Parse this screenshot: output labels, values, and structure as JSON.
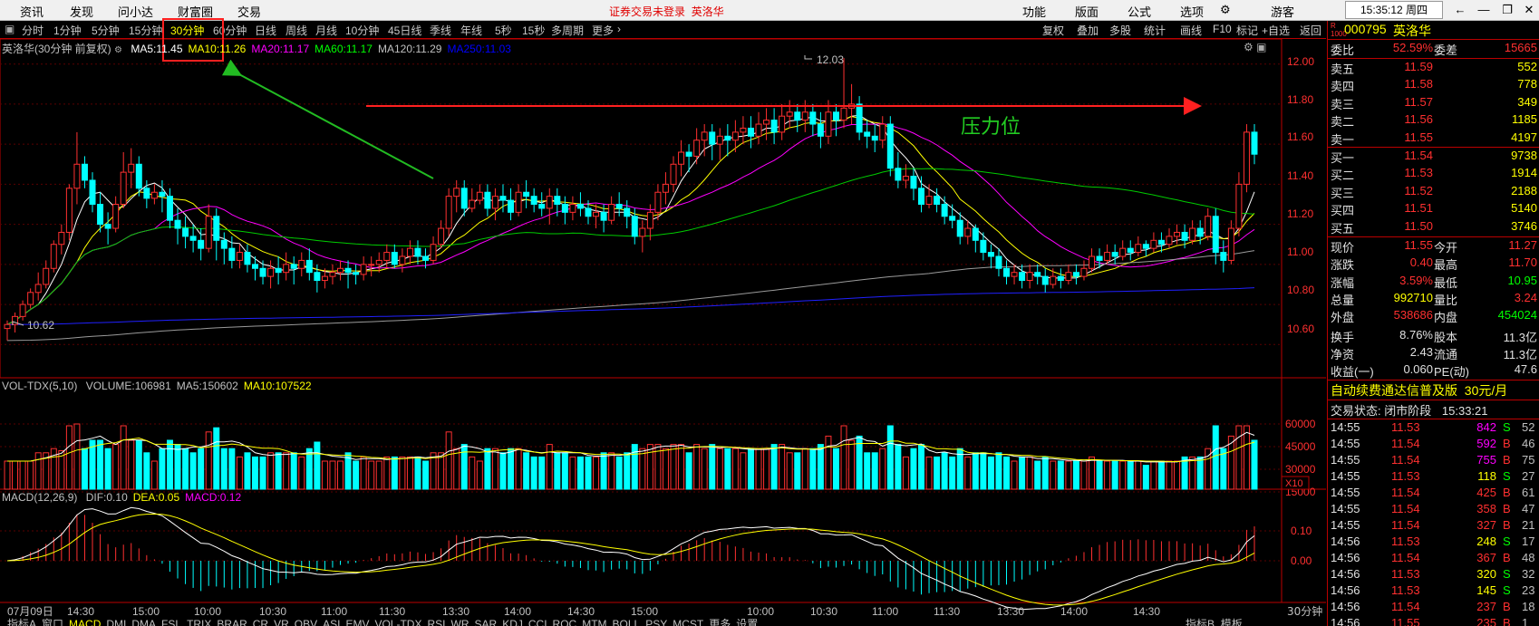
{
  "menu": {
    "items": [
      "资讯",
      "发现",
      "问小达",
      "财富圈",
      "交易"
    ],
    "notice": "证券交易未登录",
    "notice_stock": "英洛华",
    "right_items": [
      "功能",
      "版面",
      "公式",
      "选项"
    ],
    "user": "游客",
    "clock": "15:35:12 周四"
  },
  "period_tabs": [
    "分时",
    "1分钟",
    "5分钟",
    "15分钟",
    "30分钟",
    "60分钟",
    "日线",
    "周线",
    "月线",
    "10分钟",
    "45日线",
    "季线",
    "年线",
    "5秒",
    "15秒",
    "多周期",
    "更多"
  ],
  "active_period": "30分钟",
  "right_tools": [
    "复权",
    "叠加",
    "多股",
    "统计",
    "画线",
    "F10",
    "标记",
    "+自选",
    "返回"
  ],
  "main_legend": {
    "title": "英洛华(30分钟 前复权)",
    "items": [
      {
        "label": "MA5:",
        "value": "11.45",
        "color": "#ffffff"
      },
      {
        "label": "MA10:",
        "value": "11.26",
        "color": "#ffff00"
      },
      {
        "label": "MA20:",
        "value": "11.17",
        "color": "#ff00ff"
      },
      {
        "label": "MA60:",
        "value": "11.17",
        "color": "#00ff00"
      },
      {
        "label": "MA120:",
        "value": "11.29",
        "color": "#c0c0c0"
      },
      {
        "label": "MA250:",
        "value": "11.03",
        "color": "#0000ff"
      }
    ]
  },
  "annotations": {
    "pressure_label": "压力位",
    "high_label": "12.03",
    "low_label": "10.62"
  },
  "price_axis": [
    "12.00",
    "11.80",
    "11.60",
    "11.40",
    "11.20",
    "11.00",
    "10.80",
    "10.60"
  ],
  "vol_legend": {
    "title": "VOL-TDX(5,10)",
    "items": [
      {
        "label": "VOLUME:",
        "value": "106981",
        "color": "#c0c0c0"
      },
      {
        "label": "MA5:",
        "value": "150602",
        "color": "#c0c0c0"
      },
      {
        "label": "MA10:",
        "value": "107522",
        "color": "#ffff00"
      }
    ]
  },
  "vol_axis": [
    "60000",
    "45000",
    "30000",
    "15000"
  ],
  "vol_unit": "X10",
  "macd_legend": {
    "title": "MACD(12,26,9)",
    "items": [
      {
        "label": "DIF:",
        "value": "0.10",
        "color": "#c0c0c0"
      },
      {
        "label": "DEA:",
        "value": "0.05",
        "color": "#ffff00"
      },
      {
        "label": "MACD:",
        "value": "0.12",
        "color": "#ff00ff"
      }
    ]
  },
  "macd_axis": [
    "0.10",
    "0.00"
  ],
  "time_axis": [
    "07月09日",
    "14:30",
    "15:00",
    "10:00",
    "10:30",
    "11:00",
    "11:30",
    "13:30",
    "14:00",
    "14:30",
    "15:00",
    "10:00",
    "10:30",
    "11:00",
    "11:30",
    "13:30",
    "14:00",
    "14:30"
  ],
  "period_label": "30分钟",
  "indicator_tabs": [
    "指标A",
    "窗口",
    "MACD",
    "DMI",
    "DMA",
    "FSL",
    "TRIX",
    "BRAR",
    "CR",
    "VR",
    "OBV",
    "ASI",
    "EMV",
    "VOL-TDX",
    "RSI",
    "WR",
    "SAR",
    "KDJ",
    "CCI",
    "ROC",
    "MTM",
    "BOLL",
    "PSY",
    "MCST",
    "更多",
    "设置"
  ],
  "indicator_right": [
    "指标B",
    "模板"
  ],
  "quote": {
    "code": "000795",
    "name": "英洛华",
    "wei_bi_label": "委比",
    "wei_bi": "52.59%",
    "wei_cha_label": "委差",
    "wei_cha": "15665",
    "asks": [
      {
        "label": "卖五",
        "price": "11.59",
        "vol": "552"
      },
      {
        "label": "卖四",
        "price": "11.58",
        "vol": "778"
      },
      {
        "label": "卖三",
        "price": "11.57",
        "vol": "349"
      },
      {
        "label": "卖二",
        "price": "11.56",
        "vol": "1185"
      },
      {
        "label": "卖一",
        "price": "11.55",
        "vol": "4197"
      }
    ],
    "bids": [
      {
        "label": "买一",
        "price": "11.54",
        "vol": "9738"
      },
      {
        "label": "买二",
        "price": "11.53",
        "vol": "1914"
      },
      {
        "label": "买三",
        "price": "11.52",
        "vol": "2188"
      },
      {
        "label": "买四",
        "price": "11.51",
        "vol": "5140"
      },
      {
        "label": "买五",
        "price": "11.50",
        "vol": "3746"
      }
    ],
    "stats": [
      {
        "l1": "现价",
        "v1": "11.55",
        "c1": "#ff3030",
        "l2": "今开",
        "v2": "11.27",
        "c2": "#ff3030"
      },
      {
        "l1": "涨跌",
        "v1": "0.40",
        "c1": "#ff3030",
        "l2": "最高",
        "v2": "11.70",
        "c2": "#ff3030"
      },
      {
        "l1": "涨幅",
        "v1": "3.59%",
        "c1": "#ff3030",
        "l2": "最低",
        "v2": "10.95",
        "c2": "#00ff00"
      },
      {
        "l1": "总量",
        "v1": "992710",
        "c1": "#ffff00",
        "l2": "量比",
        "v2": "3.24",
        "c2": "#ff3030"
      },
      {
        "l1": "外盘",
        "v1": "538686",
        "c1": "#ff3030",
        "l2": "内盘",
        "v2": "454024",
        "c2": "#00ff00"
      },
      {
        "l1": "换手",
        "v1": "8.76%",
        "c1": "#e0e0e0",
        "l2": "股本",
        "v2": "11.3亿",
        "c2": "#e0e0e0"
      },
      {
        "l1": "净资",
        "v1": "2.43",
        "c1": "#e0e0e0",
        "l2": "流通",
        "v2": "11.3亿",
        "c2": "#e0e0e0"
      },
      {
        "l1": "收益(一)",
        "v1": "0.060",
        "c1": "#e0e0e0",
        "l2": "PE(动)",
        "v2": "47.6",
        "c2": "#e0e0e0"
      }
    ],
    "ad_text": "自动续费通达信普及版",
    "ad_price": "30元/月",
    "trade_status_label": "交易状态:",
    "trade_status": "闭市阶段",
    "trade_time": "15:33:21",
    "ticks": [
      {
        "t": "14:55",
        "p": "11.53",
        "v": "842",
        "s": "S",
        "n": "52"
      },
      {
        "t": "14:55",
        "p": "11.54",
        "v": "592",
        "s": "B",
        "n": "46"
      },
      {
        "t": "14:55",
        "p": "11.54",
        "v": "755",
        "s": "B",
        "n": "75"
      },
      {
        "t": "14:55",
        "p": "11.53",
        "v": "118",
        "s": "S",
        "n": "27"
      },
      {
        "t": "14:55",
        "p": "11.54",
        "v": "425",
        "s": "B",
        "n": "61"
      },
      {
        "t": "14:55",
        "p": "11.54",
        "v": "358",
        "s": "B",
        "n": "47"
      },
      {
        "t": "14:55",
        "p": "11.54",
        "v": "327",
        "s": "B",
        "n": "21"
      },
      {
        "t": "14:56",
        "p": "11.53",
        "v": "248",
        "s": "S",
        "n": "17"
      },
      {
        "t": "14:56",
        "p": "11.54",
        "v": "367",
        "s": "B",
        "n": "48"
      },
      {
        "t": "14:56",
        "p": "11.53",
        "v": "320",
        "s": "S",
        "n": "32"
      },
      {
        "t": "14:56",
        "p": "11.53",
        "v": "145",
        "s": "S",
        "n": "23"
      },
      {
        "t": "14:56",
        "p": "11.54",
        "v": "237",
        "s": "B",
        "n": "18"
      },
      {
        "t": "14:56",
        "p": "11.55",
        "v": "235",
        "s": "B",
        "n": "1"
      }
    ]
  },
  "chart_data": {
    "type": "candlestick",
    "title": "英洛华(30分钟 前复权)",
    "ylim": [
      10.52,
      12.08
    ],
    "candles": [
      [
        10.68,
        10.7,
        10.62,
        10.72
      ],
      [
        10.7,
        10.74,
        10.66,
        10.76
      ],
      [
        10.74,
        10.8,
        10.72,
        10.82
      ],
      [
        10.8,
        10.86,
        10.78,
        10.88
      ],
      [
        10.86,
        10.9,
        10.82,
        10.96
      ],
      [
        10.9,
        10.98,
        10.88,
        11.02
      ],
      [
        10.98,
        11.1,
        10.96,
        11.12
      ],
      [
        11.1,
        11.16,
        11.05,
        11.2
      ],
      [
        11.16,
        11.38,
        11.12,
        11.4
      ],
      [
        11.38,
        11.5,
        11.3,
        11.66
      ],
      [
        11.5,
        11.42,
        11.38,
        11.54
      ],
      [
        11.42,
        11.3,
        11.26,
        11.46
      ],
      [
        11.3,
        11.2,
        11.16,
        11.36
      ],
      [
        11.2,
        11.18,
        11.1,
        11.26
      ],
      [
        11.18,
        11.3,
        11.16,
        11.34
      ],
      [
        11.3,
        11.46,
        11.28,
        11.56
      ],
      [
        11.46,
        11.5,
        11.38,
        11.58
      ],
      [
        11.5,
        11.38,
        11.34,
        11.54
      ],
      [
        11.38,
        11.33,
        11.28,
        11.42
      ],
      [
        11.33,
        11.36,
        11.3,
        11.4
      ],
      [
        11.36,
        11.34,
        11.26,
        11.42
      ],
      [
        11.34,
        11.22,
        11.18,
        11.38
      ],
      [
        11.22,
        11.18,
        11.1,
        11.28
      ],
      [
        11.18,
        11.14,
        11.08,
        11.24
      ],
      [
        11.14,
        11.12,
        11.06,
        11.2
      ],
      [
        11.12,
        11.08,
        11.02,
        11.18
      ],
      [
        11.08,
        11.24,
        11.06,
        11.3
      ],
      [
        11.24,
        11.12,
        11.02,
        11.28
      ],
      [
        11.12,
        11.08,
        11.0,
        11.16
      ],
      [
        11.08,
        11.02,
        10.98,
        11.14
      ],
      [
        11.02,
        11.06,
        10.98,
        11.1
      ],
      [
        11.06,
        11.0,
        10.96,
        11.1
      ],
      [
        11.0,
        10.98,
        10.92,
        11.04
      ],
      [
        10.98,
        10.94,
        10.9,
        11.02
      ],
      [
        10.94,
        10.98,
        10.88,
        11.02
      ],
      [
        10.98,
        10.96,
        10.9,
        11.04
      ],
      [
        10.96,
        11.0,
        10.92,
        11.06
      ],
      [
        11.0,
        10.98,
        10.9,
        11.04
      ],
      [
        10.98,
        11.02,
        10.94,
        11.06
      ],
      [
        11.02,
        10.96,
        10.92,
        11.08
      ],
      [
        10.96,
        10.92,
        10.86,
        11.0
      ],
      [
        10.92,
        10.94,
        10.88,
        10.98
      ],
      [
        10.94,
        10.96,
        10.9,
        11.0
      ],
      [
        10.96,
        10.98,
        10.92,
        11.02
      ],
      [
        10.98,
        10.96,
        10.88,
        11.02
      ],
      [
        10.96,
        10.95,
        10.9,
        11.0
      ],
      [
        10.95,
        11.0,
        10.92,
        11.04
      ],
      [
        11.0,
        11.0,
        10.94,
        11.04
      ],
      [
        11.0,
        11.02,
        10.96,
        11.06
      ],
      [
        11.02,
        11.06,
        10.98,
        11.1
      ],
      [
        11.06,
        11.0,
        10.98,
        11.1
      ],
      [
        11.0,
        11.04,
        10.96,
        11.08
      ],
      [
        11.04,
        11.08,
        11.0,
        11.12
      ],
      [
        11.08,
        11.04,
        11.0,
        11.12
      ],
      [
        11.04,
        11.02,
        10.98,
        11.08
      ],
      [
        11.02,
        11.1,
        11.0,
        11.14
      ],
      [
        11.1,
        11.18,
        11.08,
        11.22
      ],
      [
        11.18,
        11.34,
        11.14,
        11.38
      ],
      [
        11.34,
        11.38,
        11.26,
        11.42
      ],
      [
        11.38,
        11.28,
        11.24,
        11.42
      ],
      [
        11.28,
        11.32,
        11.26,
        11.38
      ],
      [
        11.32,
        11.36,
        11.3,
        11.4
      ],
      [
        11.36,
        11.28,
        11.24,
        11.4
      ],
      [
        11.28,
        11.34,
        11.22,
        11.38
      ],
      [
        11.34,
        11.32,
        11.26,
        11.4
      ],
      [
        11.32,
        11.26,
        11.22,
        11.38
      ],
      [
        11.26,
        11.36,
        11.24,
        11.4
      ],
      [
        11.36,
        11.34,
        11.28,
        11.42
      ],
      [
        11.34,
        11.3,
        11.26,
        11.38
      ],
      [
        11.3,
        11.28,
        11.24,
        11.36
      ],
      [
        11.28,
        11.34,
        11.2,
        11.38
      ],
      [
        11.34,
        11.3,
        11.24,
        11.38
      ],
      [
        11.3,
        11.26,
        11.2,
        11.34
      ],
      [
        11.26,
        11.3,
        11.22,
        11.34
      ],
      [
        11.3,
        11.28,
        11.24,
        11.36
      ],
      [
        11.28,
        11.24,
        11.2,
        11.32
      ],
      [
        11.24,
        11.26,
        11.18,
        11.3
      ],
      [
        11.26,
        11.22,
        11.16,
        11.3
      ],
      [
        11.22,
        11.3,
        11.2,
        11.34
      ],
      [
        11.3,
        11.28,
        11.24,
        11.36
      ],
      [
        11.28,
        11.24,
        11.18,
        11.32
      ],
      [
        11.24,
        11.14,
        11.1,
        11.28
      ],
      [
        11.14,
        11.18,
        11.06,
        11.22
      ],
      [
        11.18,
        11.26,
        11.12,
        11.3
      ],
      [
        11.26,
        11.36,
        11.22,
        11.4
      ],
      [
        11.36,
        11.4,
        11.3,
        11.46
      ],
      [
        11.4,
        11.5,
        11.36,
        11.54
      ],
      [
        11.5,
        11.56,
        11.44,
        11.62
      ],
      [
        11.56,
        11.54,
        11.46,
        11.6
      ],
      [
        11.54,
        11.62,
        11.5,
        11.68
      ],
      [
        11.62,
        11.66,
        11.54,
        11.7
      ],
      [
        11.66,
        11.6,
        11.52,
        11.7
      ],
      [
        11.6,
        11.64,
        11.52,
        11.68
      ],
      [
        11.64,
        11.62,
        11.54,
        11.7
      ],
      [
        11.62,
        11.66,
        11.56,
        11.72
      ],
      [
        11.66,
        11.68,
        11.6,
        11.74
      ],
      [
        11.68,
        11.64,
        11.58,
        11.74
      ],
      [
        11.64,
        11.7,
        11.6,
        11.76
      ],
      [
        11.7,
        11.72,
        11.62,
        11.78
      ],
      [
        11.72,
        11.66,
        11.6,
        11.78
      ],
      [
        11.66,
        11.74,
        11.62,
        11.8
      ],
      [
        11.74,
        11.76,
        11.68,
        11.82
      ],
      [
        11.76,
        11.72,
        11.66,
        11.8
      ],
      [
        11.72,
        11.76,
        11.66,
        11.82
      ],
      [
        11.76,
        11.7,
        11.64,
        11.8
      ],
      [
        11.7,
        11.64,
        11.58,
        11.76
      ],
      [
        11.64,
        11.76,
        11.6,
        11.82
      ],
      [
        11.76,
        11.72,
        11.64,
        11.8
      ],
      [
        11.72,
        11.78,
        11.68,
        12.03
      ],
      [
        11.78,
        11.8,
        11.7,
        11.9
      ],
      [
        11.8,
        11.66,
        11.62,
        11.84
      ],
      [
        11.66,
        11.64,
        11.58,
        11.72
      ],
      [
        11.64,
        11.62,
        11.56,
        11.7
      ],
      [
        11.62,
        11.7,
        11.58,
        11.74
      ],
      [
        11.7,
        11.48,
        11.44,
        11.74
      ],
      [
        11.48,
        11.42,
        11.38,
        11.56
      ],
      [
        11.42,
        11.44,
        11.38,
        11.5
      ],
      [
        11.44,
        11.38,
        11.32,
        11.48
      ],
      [
        11.38,
        11.3,
        11.26,
        11.44
      ],
      [
        11.3,
        11.34,
        11.28,
        11.4
      ],
      [
        11.34,
        11.3,
        11.26,
        11.38
      ],
      [
        11.3,
        11.24,
        11.2,
        11.34
      ],
      [
        11.24,
        11.22,
        11.18,
        11.3
      ],
      [
        11.22,
        11.14,
        11.1,
        11.26
      ],
      [
        11.14,
        11.18,
        11.1,
        11.22
      ],
      [
        11.18,
        11.12,
        11.06,
        11.2
      ],
      [
        11.12,
        11.06,
        11.02,
        11.16
      ],
      [
        11.06,
        11.04,
        10.98,
        11.1
      ],
      [
        11.04,
        10.98,
        10.94,
        11.08
      ],
      [
        10.98,
        10.94,
        10.9,
        11.02
      ],
      [
        10.94,
        10.96,
        10.9,
        11.0
      ],
      [
        10.96,
        10.92,
        10.88,
        11.0
      ],
      [
        10.92,
        10.96,
        10.88,
        11.0
      ],
      [
        10.96,
        10.94,
        10.9,
        11.0
      ],
      [
        10.94,
        10.9,
        10.86,
        10.98
      ],
      [
        10.9,
        10.94,
        10.88,
        10.98
      ],
      [
        10.94,
        10.92,
        10.88,
        10.98
      ],
      [
        10.92,
        10.96,
        10.9,
        11.0
      ],
      [
        10.96,
        10.94,
        10.9,
        11.0
      ],
      [
        10.94,
        10.98,
        10.92,
        11.02
      ],
      [
        10.98,
        11.04,
        10.96,
        11.08
      ],
      [
        11.04,
        11.02,
        10.98,
        11.08
      ],
      [
        11.02,
        11.06,
        11.0,
        11.1
      ],
      [
        11.06,
        11.04,
        11.0,
        11.1
      ],
      [
        11.04,
        11.08,
        11.02,
        11.12
      ],
      [
        11.08,
        11.06,
        11.02,
        11.12
      ],
      [
        11.06,
        11.1,
        11.04,
        11.14
      ],
      [
        11.1,
        11.08,
        11.04,
        11.12
      ],
      [
        11.08,
        11.12,
        11.06,
        11.16
      ],
      [
        11.12,
        11.1,
        11.06,
        11.16
      ],
      [
        11.1,
        11.14,
        11.08,
        11.18
      ],
      [
        11.14,
        11.16,
        11.1,
        11.2
      ],
      [
        11.16,
        11.12,
        11.08,
        11.2
      ],
      [
        11.12,
        11.18,
        11.1,
        11.22
      ],
      [
        11.18,
        11.14,
        11.1,
        11.22
      ],
      [
        11.14,
        11.24,
        11.12,
        11.28
      ],
      [
        11.24,
        11.06,
        11.0,
        11.28
      ],
      [
        11.06,
        11.02,
        10.96,
        11.12
      ],
      [
        11.02,
        11.18,
        11.0,
        11.22
      ],
      [
        11.18,
        11.4,
        11.14,
        11.46
      ],
      [
        11.4,
        11.66,
        11.36,
        11.7
      ],
      [
        11.66,
        11.55,
        11.5,
        11.7
      ]
    ],
    "time_labels": [
      "07月09日",
      "14:30",
      "15:00",
      "10:00",
      "10:30",
      "11:00",
      "11:30",
      "13:30",
      "14:00",
      "14:30",
      "15:00",
      "10:00",
      "10:30",
      "11:00",
      "11:30",
      "13:30",
      "14:00",
      "14:30"
    ]
  }
}
